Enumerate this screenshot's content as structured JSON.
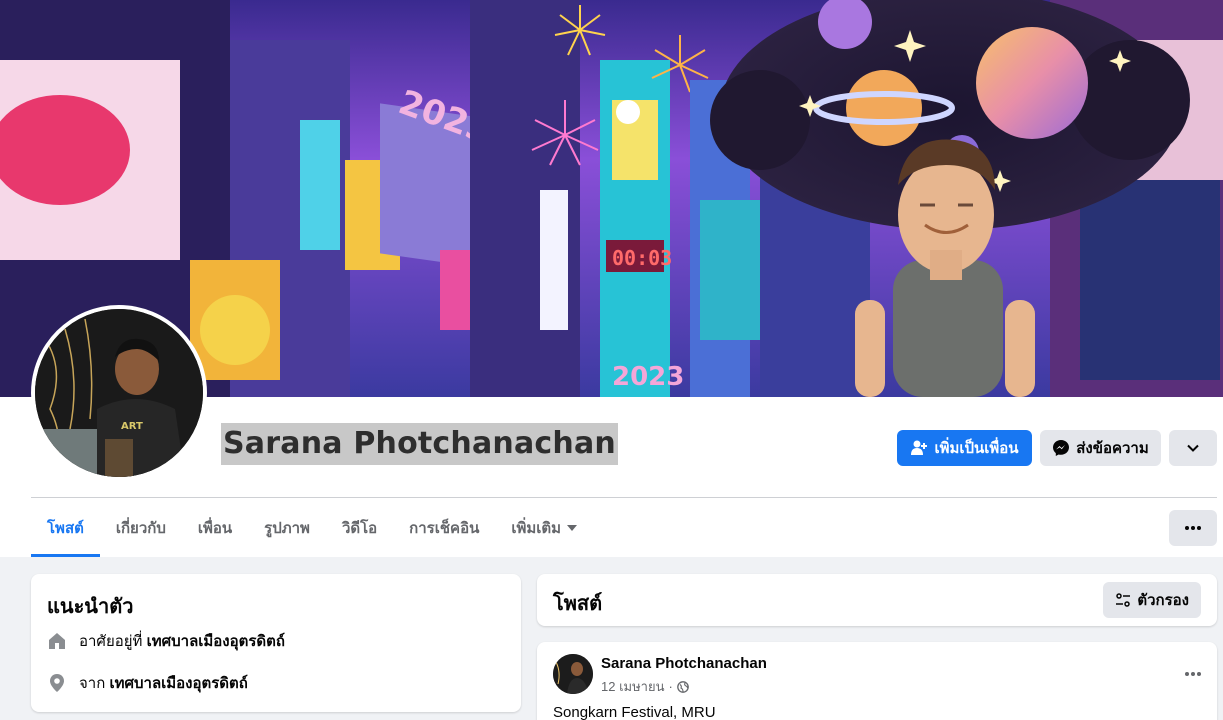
{
  "profile": {
    "name": "Sarana Photchanachan"
  },
  "actions": {
    "add_friend": "เพิ่มเป็นเพื่อน",
    "message": "ส่งข้อความ"
  },
  "tabs": [
    {
      "label": "โพสต์"
    },
    {
      "label": "เกี่ยวกับ"
    },
    {
      "label": "เพื่อน"
    },
    {
      "label": "รูปภาพ"
    },
    {
      "label": "วิดีโอ"
    },
    {
      "label": "การเช็คอิน"
    },
    {
      "label": "เพิ่มเติม"
    }
  ],
  "intro": {
    "title": "แนะนำตัว",
    "lives_prefix": "อาศัยอยู่ที่",
    "lives_place": "เทศบาลเมืองอุตรดิตถ์",
    "from_prefix": "จาก",
    "from_place": "เทศบาลเมืองอุตรดิตถ์"
  },
  "posts": {
    "title": "โพสต์",
    "filter_label": "ตัวกรอง",
    "items": [
      {
        "author": "Sarana Photchanachan",
        "date": "12 เมษายน",
        "text": "Songkarn Festival, MRU"
      }
    ]
  },
  "cover_text": {
    "year_sign": "2023",
    "year_bottom": "2023",
    "clock": "00:03"
  },
  "colors": {
    "accent": "#1877f2",
    "page_bg": "#f0f2f5",
    "button_gray": "#e4e6eb",
    "muted_text": "#65676b"
  }
}
